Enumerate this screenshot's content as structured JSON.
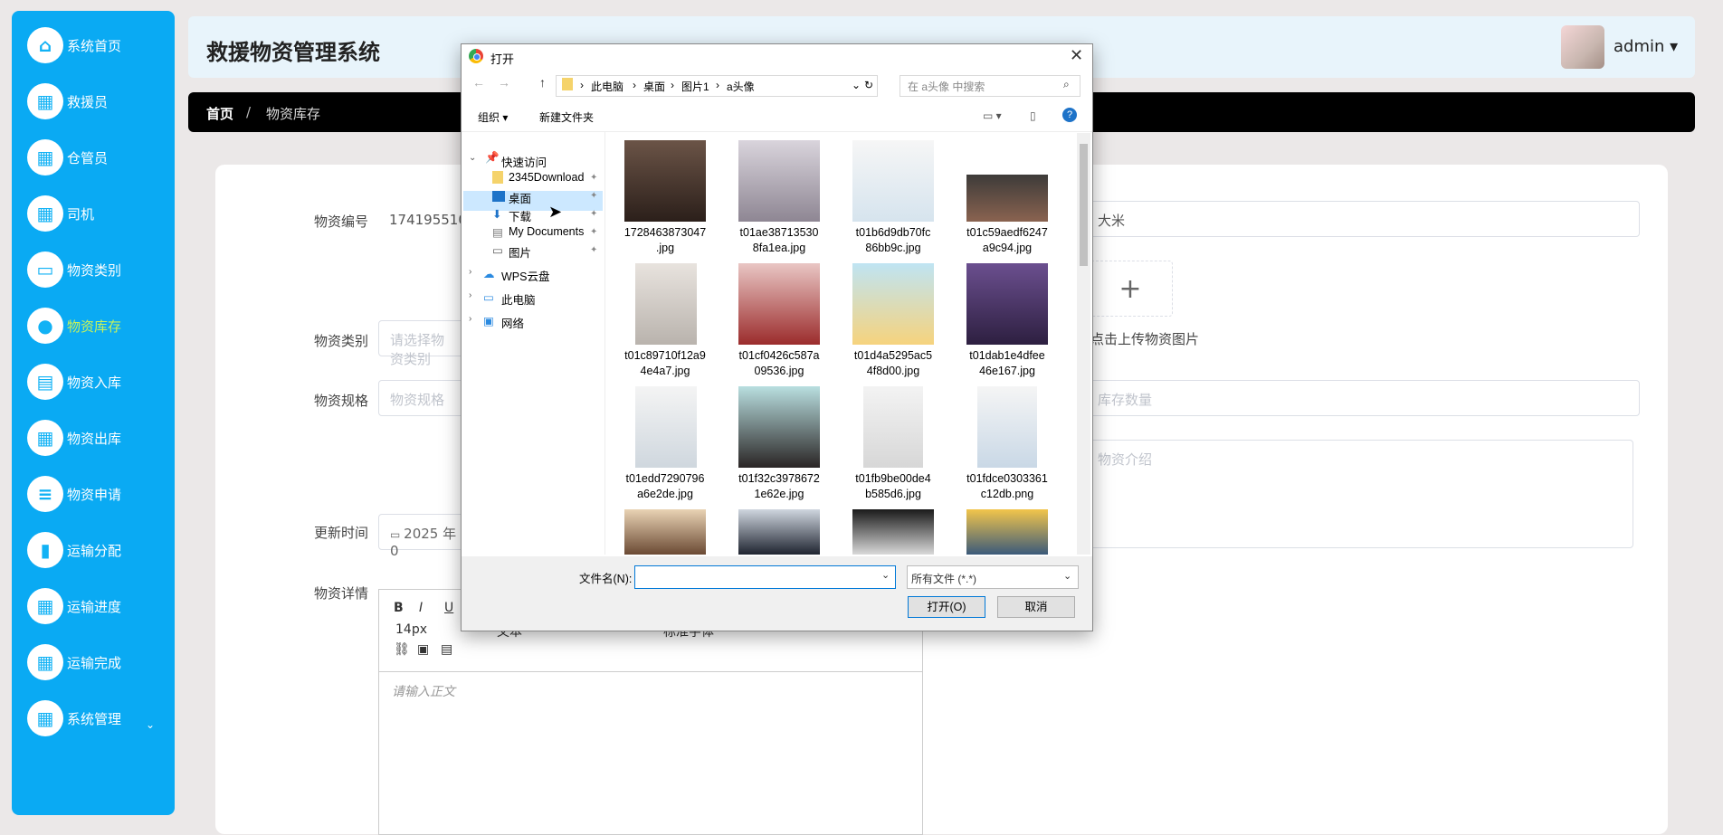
{
  "sidebar": {
    "items": [
      {
        "label": "系统首页",
        "icon": "home-icon"
      },
      {
        "label": "救援员",
        "icon": "grid-icon"
      },
      {
        "label": "仓管员",
        "icon": "grid-icon"
      },
      {
        "label": "司机",
        "icon": "grid-icon"
      },
      {
        "label": "物资类别",
        "icon": "monitor-icon"
      },
      {
        "label": "物资库存",
        "icon": "bulb-icon"
      },
      {
        "label": "物资入库",
        "icon": "clipboard-icon"
      },
      {
        "label": "物资出库",
        "icon": "grid-icon"
      },
      {
        "label": "物资申请",
        "icon": "sliders-icon"
      },
      {
        "label": "运输分配",
        "icon": "bar-chart-icon"
      },
      {
        "label": "运输进度",
        "icon": "grid-icon"
      },
      {
        "label": "运输完成",
        "icon": "grid-icon"
      },
      {
        "label": "系统管理",
        "icon": "grid-icon"
      }
    ],
    "active_index": 5
  },
  "header": {
    "title": "救援物资管理系统",
    "user": "admin ▾"
  },
  "breadcrumb": {
    "home": "首页",
    "separator": "/",
    "current": "物资库存"
  },
  "form": {
    "code_label": "物资编号",
    "code_value": "17419551039",
    "name_value": "大米",
    "category_label": "物资类别",
    "category_placeholder": "请选择物资类别",
    "spec_label": "物资规格",
    "spec_placeholder": "物资规格",
    "upload_plus": "+",
    "upload_tip": "点击上传物资图片",
    "stock_placeholder": "库存数量",
    "intro_placeholder": "物资介绍",
    "update_label": "更新时间",
    "update_value": "2025 年 0",
    "detail_label": "物资详情",
    "editor": {
      "bold": "B",
      "italic": "I",
      "underline": "U",
      "font_size": "14px",
      "text": "文本",
      "font": "标准字体",
      "placeholder": "请输入正文"
    }
  },
  "dialog": {
    "title": "打开",
    "close": "✕",
    "path": [
      "此电脑",
      "桌面",
      "图片1",
      "a头像"
    ],
    "search_placeholder": "在 a头像 中搜索",
    "organize": "组织 ▾",
    "new_folder": "新建文件夹",
    "nav": {
      "quick_access": "快速访问",
      "quick_items": [
        "2345Download",
        "桌面",
        "下载",
        "My Documents",
        "图片"
      ],
      "wps": "WPS云盘",
      "pc": "此电脑",
      "network": "网络"
    },
    "files": [
      [
        "1728463873047",
        ".jpg"
      ],
      [
        "t01ae38713530",
        "8fa1ea.jpg"
      ],
      [
        "t01b6d9db70fc",
        "86bb9c.jpg"
      ],
      [
        "t01c59aedf6247",
        "a9c94.jpg"
      ],
      [
        "t01c89710f12a9",
        "4e4a7.jpg"
      ],
      [
        "t01cf0426c587a",
        "09536.jpg"
      ],
      [
        "t01d4a5295ac5",
        "4f8d00.jpg"
      ],
      [
        "t01dab1e4dfee",
        "46e167.jpg"
      ],
      [
        "t01edd7290796",
        "a6e2de.jpg"
      ],
      [
        "t01f32c3978672",
        "1e62e.jpg"
      ],
      [
        "t01fb9be00de4",
        "b585d6.jpg"
      ],
      [
        "t01fdce0303361",
        "c12db.png"
      ]
    ],
    "filename_label": "文件名(N):",
    "filename_value": "",
    "filter": "所有文件 (*.*)",
    "open_button": "打开(O)",
    "cancel_button": "取消"
  },
  "colors": {
    "sidebar": "#0aaaf3",
    "active_label": "#c8f25a",
    "accent": "#0078d7"
  }
}
